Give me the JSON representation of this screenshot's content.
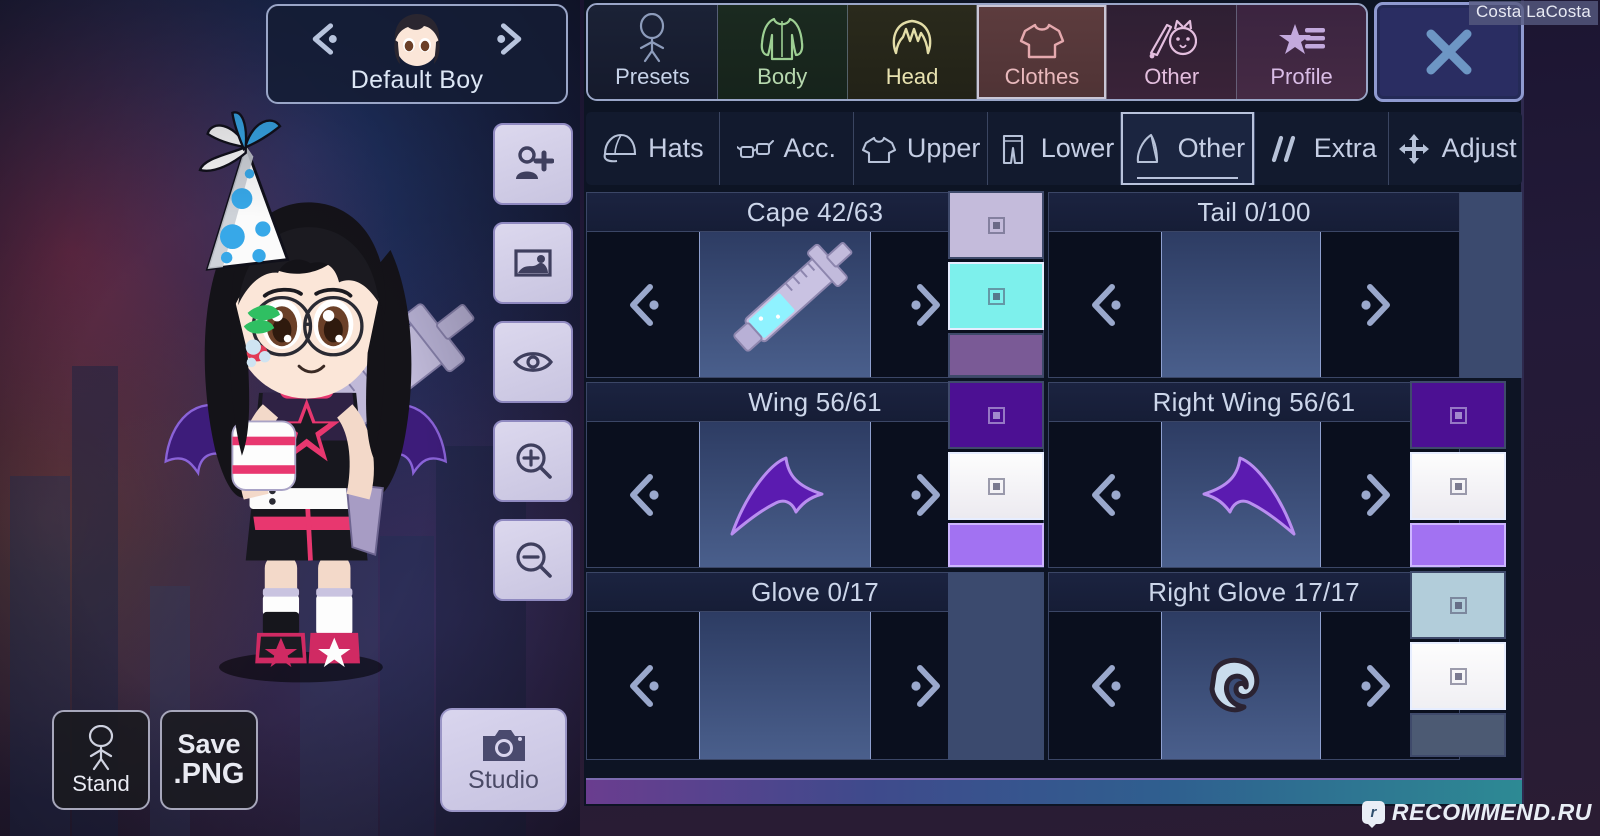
{
  "character_select": {
    "name": "Default Boy",
    "prev_icon": "chevron-left-icon",
    "next_icon": "chevron-right-icon",
    "face_icon": "character-face-icon"
  },
  "tool_rail": [
    {
      "icon": "add-person-icon",
      "name": "add-character-button"
    },
    {
      "icon": "image-icon",
      "name": "background-button"
    },
    {
      "icon": "eye-icon",
      "name": "preview-toggle-button"
    },
    {
      "icon": "zoom-in-icon",
      "name": "zoom-in-button"
    },
    {
      "icon": "zoom-out-icon",
      "name": "zoom-out-button"
    }
  ],
  "stage_buttons": {
    "stand_label": "Stand",
    "save_line1": "Save",
    "save_line2": ".PNG",
    "studio_label": "Studio"
  },
  "main_tabs": [
    {
      "label": "Presets",
      "icon": "body-outline-icon",
      "selected": false
    },
    {
      "label": "Body",
      "icon": "jacket-icon",
      "selected": false
    },
    {
      "label": "Head",
      "icon": "hair-icon",
      "selected": false
    },
    {
      "label": "Clothes",
      "icon": "tshirt-icon",
      "selected": true
    },
    {
      "label": "Other",
      "icon": "sword-cat-icon",
      "selected": false
    },
    {
      "label": "Profile",
      "icon": "star-list-icon",
      "selected": false
    }
  ],
  "close_button": {
    "label": "X",
    "icon": "close-x-icon"
  },
  "sub_tabs": [
    {
      "label": "Hats",
      "icon": "cap-icon",
      "selected": false
    },
    {
      "label": "Acc.",
      "icon": "glasses-icon",
      "selected": false
    },
    {
      "label": "Upper",
      "icon": "tshirt-icon",
      "selected": false
    },
    {
      "label": "Lower",
      "icon": "pants-icon",
      "selected": false
    },
    {
      "label": "Other",
      "icon": "cape-icon",
      "selected": true
    },
    {
      "label": "Extra",
      "icon": "slashes-icon",
      "selected": false
    },
    {
      "label": "Adjust",
      "icon": "move-arrows-icon",
      "selected": false
    }
  ],
  "slots": [
    {
      "name": "cape",
      "title": "Cape 42/63",
      "item_index": 42,
      "item_total": 63,
      "preview_icon": "syringe-icon",
      "has_item": true,
      "swatches": [
        {
          "color": "#c4bbdb",
          "selected": false
        },
        {
          "color": "#7df0ec",
          "selected": true
        },
        {
          "color": "#7a5a96",
          "selected": false
        }
      ]
    },
    {
      "name": "tail",
      "title": "Tail 0/100",
      "item_index": 0,
      "item_total": 100,
      "preview_icon": "none",
      "has_item": false,
      "swatches": []
    },
    {
      "name": "wing",
      "title": "Wing 56/61",
      "item_index": 56,
      "item_total": 61,
      "preview_icon": "bat-wing-left-icon",
      "has_item": true,
      "swatches": [
        {
          "color": "#4c1093",
          "selected": false
        },
        {
          "color": "#f4f4f4",
          "selected": true
        },
        {
          "color": "#a272f2",
          "selected": false
        }
      ]
    },
    {
      "name": "right-wing",
      "title": "Right Wing 56/61",
      "item_index": 56,
      "item_total": 61,
      "preview_icon": "bat-wing-right-icon",
      "has_item": true,
      "swatches": [
        {
          "color": "#4c1093",
          "selected": false
        },
        {
          "color": "#f4f4f4",
          "selected": true
        },
        {
          "color": "#a272f2",
          "selected": false
        }
      ]
    },
    {
      "name": "glove",
      "title": "Glove 0/17",
      "item_index": 0,
      "item_total": 17,
      "preview_icon": "none",
      "has_item": false,
      "swatches": []
    },
    {
      "name": "right-glove",
      "title": "Right Glove 17/17",
      "item_index": 17,
      "item_total": 17,
      "preview_icon": "glove-icon",
      "has_item": true,
      "swatches": [
        {
          "color": "#b2cdda",
          "selected": false
        },
        {
          "color": "#f8f8f8",
          "selected": true
        },
        {
          "color": "#4c5a73",
          "selected": false
        }
      ]
    }
  ],
  "watermarks": {
    "top_right": "Costa LaCosta",
    "bottom_right": "RECOMMEND.RU",
    "bottom_badge": "r"
  },
  "colors": {
    "selected_tab": "#5d3c3e",
    "panel_bg": "#0d1424",
    "accent_border": "#9aa6c8",
    "title_text": "#ccd6ea"
  }
}
